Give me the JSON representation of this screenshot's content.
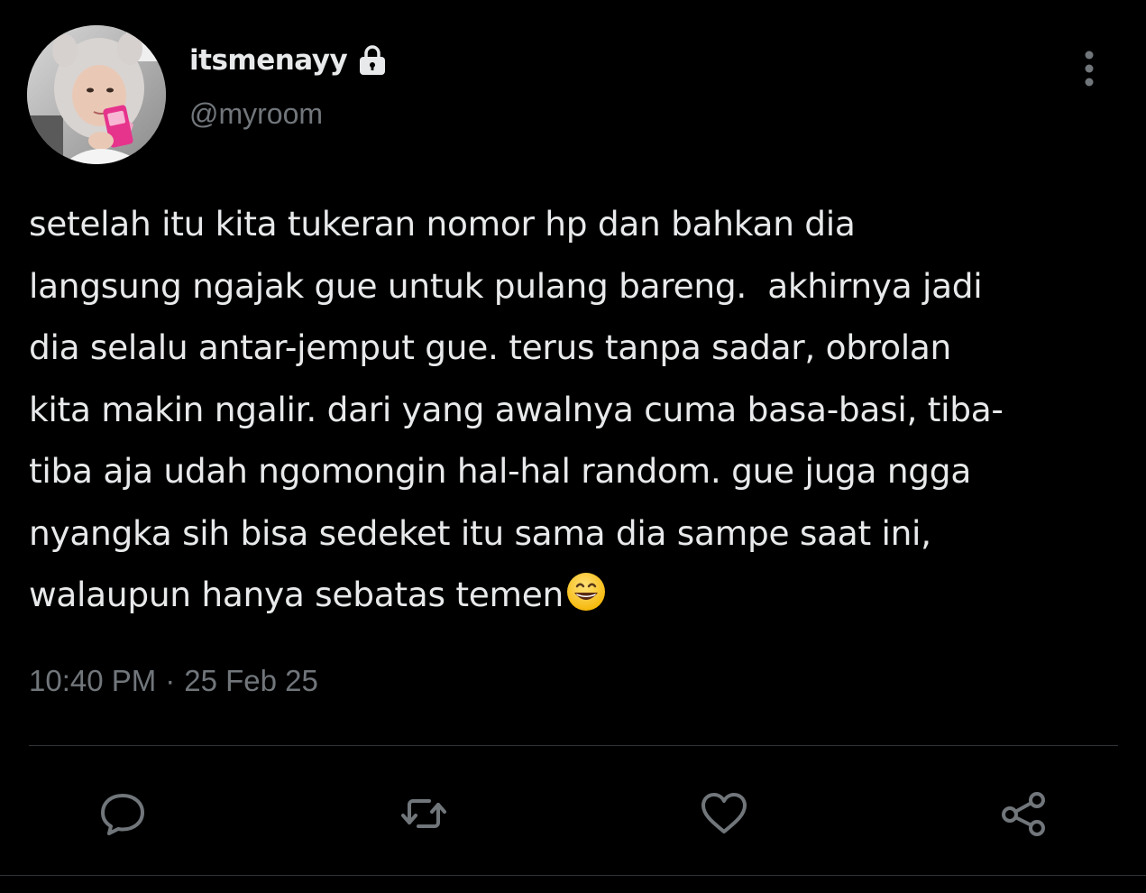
{
  "author": {
    "display_name": "itsmenayy",
    "handle": "@myroom",
    "protected_icon": "lock-icon",
    "avatar_icon": "profile-photo"
  },
  "tweet": {
    "lines": [
      "setelah itu kita tukeran nomor hp dan bahkan dia",
      "langsung ngajak gue untuk pulang bareng.  akhirnya jadi",
      "dia selalu antar-jemput gue. terus tanpa sadar, obrolan",
      "kita makin ngalir. dari yang awalnya cuma basa-basi, tiba-",
      "tiba aja udah ngomongin hal-hal random. gue juga ngga",
      "nyangka sih bisa sedeket itu sama dia sampe saat ini,",
      "walaupun hanya sebatas temen"
    ],
    "trailing_emoji": "grinning-face-with-smiling-eyes-emoji",
    "time": "10:40 PM",
    "separator": "·",
    "date": "25 Feb 25"
  },
  "actions": {
    "reply_icon": "reply-icon",
    "retweet_icon": "retweet-icon",
    "like_icon": "heart-icon",
    "share_icon": "share-icon"
  },
  "menu": {
    "more_icon": "more-vertical-icon"
  },
  "colors": {
    "background": "#000000",
    "text_primary": "#e7e9ea",
    "text_secondary": "#71767b",
    "divider": "#2f3336"
  }
}
